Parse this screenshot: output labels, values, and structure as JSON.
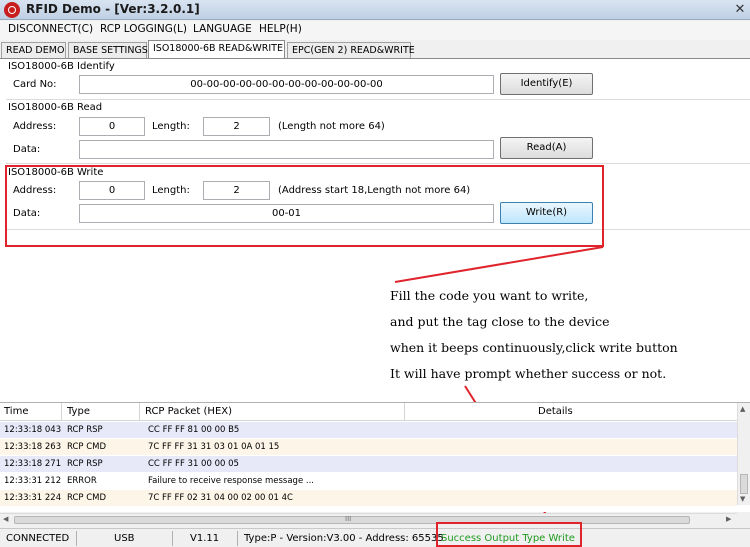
{
  "window": {
    "title": "RFID Demo - [Ver:3.2.0.1]",
    "close_glyph": "✕",
    "app_icon": "rfid-app-icon"
  },
  "menu": {
    "items": [
      "DISCONNECT(C)",
      "RCP LOGGING(L)",
      "LANGUAGE",
      "HELP(H)"
    ]
  },
  "tabs": {
    "items": [
      "READ DEMO",
      "BASE SETTINGS",
      "ISO18000-6B READ&WRITE",
      "EPC(GEN 2) READ&WRITE"
    ],
    "active": 2
  },
  "identify": {
    "title": "ISO18000-6B Identify",
    "card_label": "Card No:",
    "card_value": "00-00-00-00-00-00-00-00-00-00-00-00",
    "button": "Identify(E)"
  },
  "read": {
    "title": "ISO18000-6B Read",
    "address_label": "Address:",
    "address_value": "0",
    "length_label": "Length:",
    "length_value": "2",
    "hint": "(Length not more 64)",
    "data_label": "Data:",
    "data_value": "",
    "button": "Read(A)"
  },
  "write": {
    "title": "ISO18000-6B Write",
    "address_label": "Address:",
    "address_value": "0",
    "length_label": "Length:",
    "length_value": "2",
    "hint": "(Address start 18,Length not more 64)",
    "data_label": "Data:",
    "data_value": "00-01",
    "button": "Write(R)"
  },
  "annotation": {
    "lines": [
      "Fill the code you want to write,",
      "and put the tag close to the device",
      "when it beeps continuously,click write button",
      "It will have prompt whether success or not."
    ],
    "color": "#e0242c"
  },
  "log": {
    "columns": [
      "Time",
      "Type",
      "RCP Packet (HEX)",
      "Details"
    ],
    "rows": [
      {
        "time": "12:33:18 043",
        "type": "RCP RSP",
        "packet": "CC FF FF 81 00 00 B5"
      },
      {
        "time": "12:33:18 263",
        "type": "RCP CMD",
        "packet": "7C FF FF 31 31 03 01 0A 01 15"
      },
      {
        "time": "12:33:18 271",
        "type": "RCP RSP",
        "packet": "CC FF FF 31 00 00 05"
      },
      {
        "time": "12:33:31 212",
        "type": "ERROR",
        "packet": "Failure to receive response message ..."
      },
      {
        "time": "12:33:31 224",
        "type": "RCP CMD",
        "packet": "7C FF FF 02 31 04 00 02 00 01 4C"
      }
    ],
    "scroll_glyph": "III"
  },
  "status": {
    "connection": "CONNECTED",
    "port": "USB",
    "version": "V1.11",
    "device": "Type:P - Version:V3.00 - Address: 65535",
    "message": "Success Output Type Write",
    "message_color": "#1f9a1f"
  }
}
